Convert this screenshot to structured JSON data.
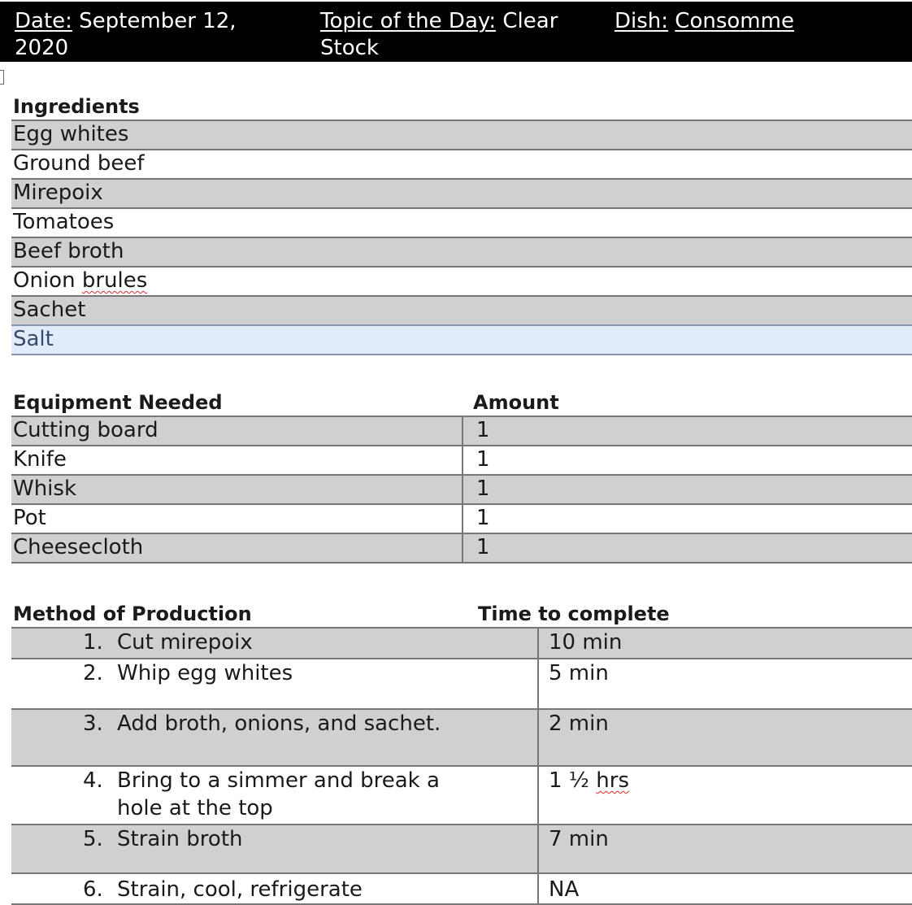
{
  "header": {
    "date_label": "Date:",
    "date_value": " September 12,",
    "date_value_2": "2020",
    "topic_label": "Topic of the Day:",
    "topic_value": " Clear",
    "topic_value_2": "Stock",
    "dish_label": "Dish:",
    "dish_value": "Consomme"
  },
  "ingredients": {
    "heading": "Ingredients",
    "items": [
      "Egg whites",
      "Ground beef",
      "Mirepoix",
      "Tomatoes",
      "Beef broth",
      "Onion ",
      "Sachet",
      "Salt"
    ],
    "misspelled_word": "brules"
  },
  "equipment": {
    "heading": "Equipment Needed",
    "amount_heading": "Amount",
    "rows": [
      {
        "item": "Cutting board",
        "amount": "1"
      },
      {
        "item": "Knife",
        "amount": "1"
      },
      {
        "item": "Whisk",
        "amount": "1"
      },
      {
        "item": "Pot",
        "amount": "1"
      },
      {
        "item": "Cheesecloth",
        "amount": "1"
      }
    ]
  },
  "method": {
    "heading": "Method of Production",
    "time_heading": "Time to complete",
    "steps": [
      {
        "num": "1.",
        "text": "Cut mirepoix",
        "time": "10 min"
      },
      {
        "num": "2.",
        "text": "Whip egg whites",
        "time": "5 min"
      },
      {
        "num": "3.",
        "text": "Add broth, onions, and sachet.",
        "time": "2 min"
      },
      {
        "num": "4.",
        "text": "Bring to a simmer and break a hole at the top",
        "time": "1 ½ ",
        "time_squiggle": "hrs"
      },
      {
        "num": "5.",
        "text": "Strain broth",
        "time": "7 min"
      },
      {
        "num": "6.",
        "text": "Strain, cool, refrigerate",
        "time": "NA"
      }
    ]
  }
}
